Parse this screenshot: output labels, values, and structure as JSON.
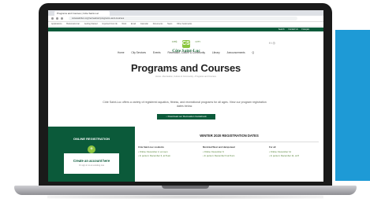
{
  "browser": {
    "tab_title": "Programs and Courses | Côte Saint-Luc",
    "url": "cotesaintluc.org/recreation/programs-and-courses",
    "bookmarks": [
      "Applications",
      "Bookmarks bar",
      "Getting Started",
      "Imported From IE",
      "Work",
      "Email",
      "Calendar",
      "Documents",
      "News",
      "Other bookmarks"
    ]
  },
  "site": {
    "top_links": [
      "Search",
      "Contact Us",
      "Français"
    ],
    "logo": {
      "mark": "CSL",
      "left": "CITÉ",
      "right": "CITY",
      "name": "Côte Saint-Luc"
    },
    "social": "f  t  ◎",
    "nav": [
      "Home",
      "City Services",
      "Events",
      "Recreation, Culture & Community",
      "Library",
      "Announcements",
      "Q"
    ],
    "title": "Programs and Courses",
    "breadcrumb": "Home › Recreation, Culture & Community › Programs and Courses",
    "intro": "Côte Saint-Luc offers a variety of registered aquatics, fitness, and recreational programs for all ages. View our program registration dates below.",
    "download_label": "↓ Download our Recreation Guidebook",
    "online_registration": {
      "title": "ONLINE REGISTRATION",
      "icon": "+",
      "card_title": "Create an account here",
      "card_sub": "Or sign in to an existing one"
    },
    "winter": {
      "title": "WINTER 2020 REGISTRATION DATES",
      "columns": [
        {
          "heading": "Côte Saint-Luc residents",
          "items": [
            "• Online: December 2, at noon",
            "• In person: December 3, at 8 am"
          ]
        },
        {
          "heading": "Montréal West and Hampstead",
          "items": [
            "• Online: December 9",
            "• In person: December 9 at 8 am"
          ]
        },
        {
          "heading": "For all",
          "items": [
            "• Online: December 11",
            "• In person: December 11, at 8"
          ]
        }
      ]
    }
  },
  "colors": {
    "brand_green": "#0b5a3a",
    "accent_green": "#8bc53f",
    "teal_block": "#1e9ad6"
  }
}
